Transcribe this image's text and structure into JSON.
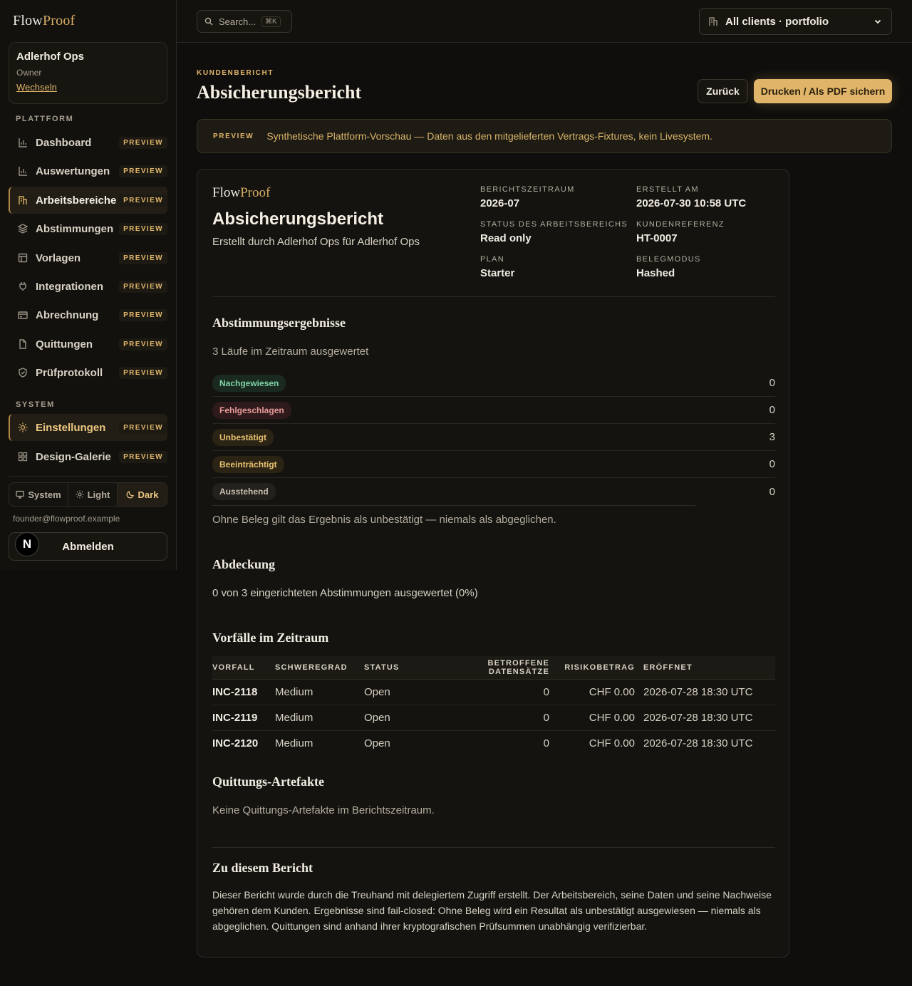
{
  "brand": {
    "part1": "Flow",
    "part2": "Proof"
  },
  "org": {
    "name": "Adlerhof Ops",
    "role": "Owner",
    "switch_label": "Wechseln"
  },
  "sidebar": {
    "platform_label": "PLATTFORM",
    "system_label": "SYSTEM",
    "badge": "PREVIEW",
    "items": [
      {
        "label": "Dashboard",
        "icon": "chart-icon"
      },
      {
        "label": "Auswertungen",
        "icon": "chart-icon"
      },
      {
        "label": "Arbeitsbereiche",
        "icon": "building-icon"
      },
      {
        "label": "Abstimmungen",
        "icon": "layers-icon"
      },
      {
        "label": "Vorlagen",
        "icon": "template-icon"
      },
      {
        "label": "Integrationen",
        "icon": "plug-icon"
      },
      {
        "label": "Abrechnung",
        "icon": "card-icon"
      },
      {
        "label": "Quittungen",
        "icon": "file-icon"
      },
      {
        "label": "Prüfprotokoll",
        "icon": "shield-icon"
      }
    ],
    "system_items": [
      {
        "label": "Einstellungen",
        "icon": "sun-icon"
      },
      {
        "label": "Design-Galerie",
        "icon": "grid-icon"
      }
    ],
    "active_item": "Arbeitsbereiche",
    "theme": {
      "system": "System",
      "light": "Light",
      "dark": "Dark",
      "selected": "Dark"
    },
    "user_email": "founder@flowproof.example",
    "logout_label": "Abmelden",
    "avatar_letter": "N"
  },
  "topbar": {
    "search_placeholder": "Search...",
    "search_shortcut": "⌘K",
    "client_select": "All clients · portfolio"
  },
  "header": {
    "eyebrow": "KUNDENBERICHT",
    "title": "Absicherungsbericht",
    "back_label": "Zurück",
    "print_label": "Drucken / Als PDF sichern"
  },
  "preview_banner": {
    "tag": "PREVIEW",
    "text": "Synthetische Plattform-Vorschau — Daten aus den mitgelieferten Vertrags-Fixtures, kein Livesystem."
  },
  "report": {
    "title": "Absicherungsbericht",
    "subtitle": "Erstellt durch Adlerhof Ops für Adlerhof Ops",
    "meta": {
      "period_label": "BERICHTSZEITRAUM",
      "period": "2026-07",
      "created_label": "ERSTELLT AM",
      "created": "2026-07-30 10:58 UTC",
      "ws_status_label": "STATUS DES ARBEITSBEREICHS",
      "ws_status": "Read only",
      "client_ref_label": "KUNDENREFERENZ",
      "client_ref": "HT-0007",
      "plan_label": "PLAN",
      "plan": "Starter",
      "proof_mode_label": "BELEGMODUS",
      "proof_mode": "Hashed"
    },
    "results": {
      "heading": "Abstimmungsergebnisse",
      "summary": "3 Läufe im Zeitraum ausgewertet",
      "rows": [
        {
          "label": "Nachgewiesen",
          "count": "0"
        },
        {
          "label": "Fehlgeschlagen",
          "count": "0"
        },
        {
          "label": "Unbestätigt",
          "count": "3"
        },
        {
          "label": "Beeinträchtigt",
          "count": "0"
        },
        {
          "label": "Ausstehend",
          "count": "0"
        }
      ],
      "note": "Ohne Beleg gilt das Ergebnis als unbestätigt — niemals als abgeglichen."
    },
    "coverage": {
      "heading": "Abdeckung",
      "text": "0 von 3 eingerichteten Abstimmungen ausgewertet (0%)"
    },
    "incidents": {
      "heading": "Vorfälle im Zeitraum",
      "columns": [
        "VORFALL",
        "SCHWEREGRAD",
        "STATUS",
        "BETROFFENE DATENSÄTZE",
        "RISIKOBETRAG",
        "ERÖFFNET"
      ],
      "rows": [
        {
          "id": "INC-2118",
          "severity": "Medium",
          "status": "Open",
          "records": "0",
          "risk": "CHF 0.00",
          "opened": "2026-07-28 18:30 UTC"
        },
        {
          "id": "INC-2119",
          "severity": "Medium",
          "status": "Open",
          "records": "0",
          "risk": "CHF 0.00",
          "opened": "2026-07-28 18:30 UTC"
        },
        {
          "id": "INC-2120",
          "severity": "Medium",
          "status": "Open",
          "records": "0",
          "risk": "CHF 0.00",
          "opened": "2026-07-28 18:30 UTC"
        }
      ]
    },
    "receipts": {
      "heading": "Quittungs-Artefakte",
      "text": "Keine Quittungs-Artefakte im Berichtszeitraum."
    },
    "about": {
      "heading": "Zu diesem Bericht",
      "text": "Dieser Bericht wurde durch die Treuhand mit delegiertem Zugriff erstellt. Der Arbeitsbereich, seine Daten und seine Nachweise gehören dem Kunden. Ergebnisse sind fail-closed: Ohne Beleg wird ein Resultat als unbestätigt ausgewiesen — niemals als abgeglichen. Quittungen sind anhand ihrer kryptografischen Prüfsummen unabhängig verifizierbar."
    }
  }
}
